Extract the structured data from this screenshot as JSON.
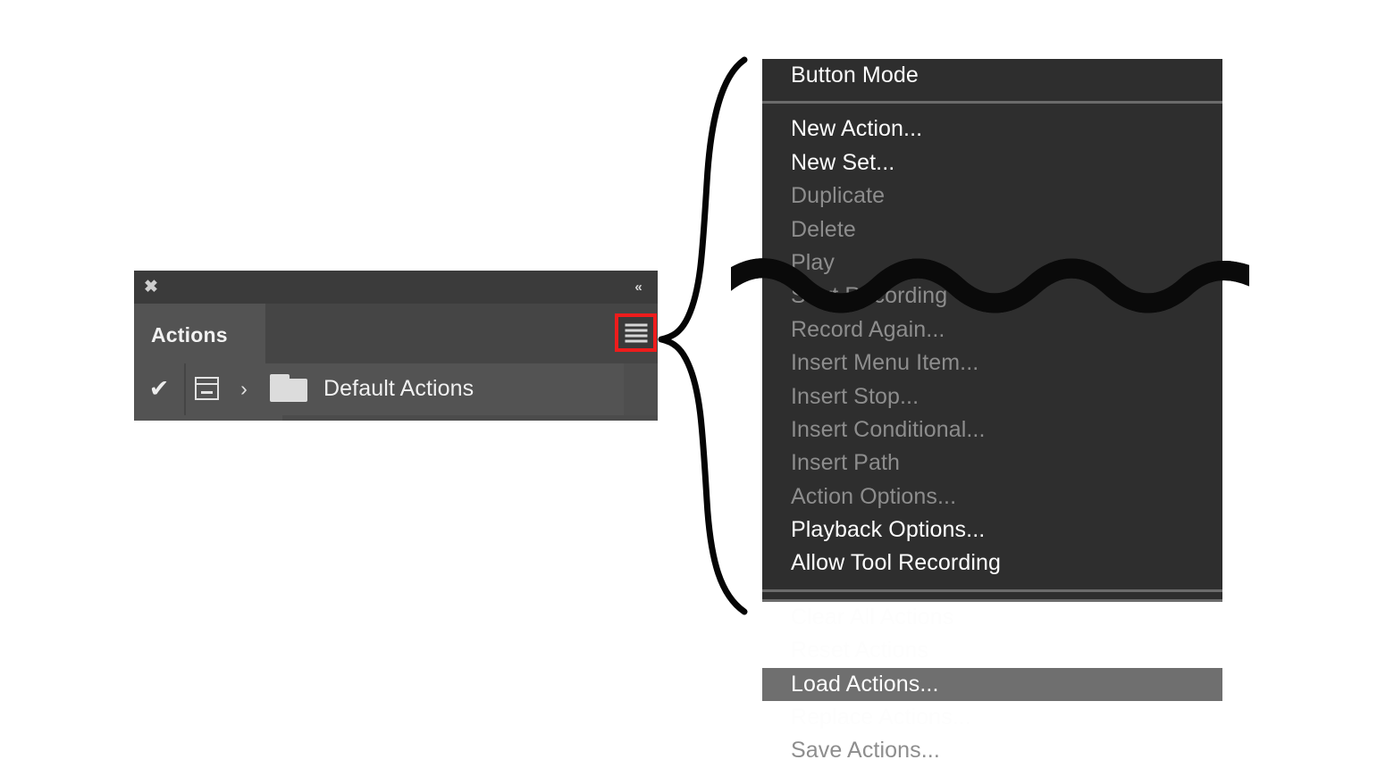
{
  "panel": {
    "title_tab": "Actions",
    "close_icon": "close-icon",
    "close_glyph": "✖",
    "collapse_icon": "double-chevron-left-icon",
    "collapse_glyph": "«",
    "menu_icon": "hamburger-menu-icon",
    "highlight_color": "#ee1c1c",
    "background_color": "#535353",
    "titlebar_color": "#3b3b3b",
    "row": {
      "check_glyph": "✔",
      "check_icon": "checkmark-icon",
      "dialog_icon": "toggle-dialog-icon",
      "expand_glyph": "›",
      "expand_icon": "chevron-right-icon",
      "folder_icon": "folder-icon",
      "label": "Default Actions"
    }
  },
  "flyout_menu": {
    "background_color": "#2e2e2e",
    "highlight_color": "#6f6f6f",
    "text_color": "#fdfdfd",
    "disabled_color": "#8d8d8d",
    "groups": [
      {
        "items": [
          {
            "label": "Button Mode",
            "state": "enabled"
          }
        ]
      },
      {
        "items": [
          {
            "label": "New Action...",
            "state": "enabled"
          },
          {
            "label": "New Set...",
            "state": "enabled"
          },
          {
            "label": "Duplicate",
            "state": "disabled"
          },
          {
            "label": "Delete",
            "state": "disabled"
          },
          {
            "label": "Play",
            "state": "disabled"
          },
          {
            "label": "Start Recording",
            "state": "disabled"
          },
          {
            "label": "Record Again...",
            "state": "disabled"
          },
          {
            "label": "Insert Menu Item...",
            "state": "disabled"
          },
          {
            "label": "Insert Stop...",
            "state": "disabled"
          },
          {
            "label": "Insert Conditional...",
            "state": "disabled"
          },
          {
            "label": "Insert Path",
            "state": "disabled"
          },
          {
            "label": "Action Options...",
            "state": "disabled"
          },
          {
            "label": "Playback Options...",
            "state": "enabled"
          },
          {
            "label": "Allow Tool Recording",
            "state": "enabled"
          }
        ]
      },
      {
        "items": [
          {
            "label": "Clear All Actions",
            "state": "enabled"
          },
          {
            "label": "Reset Actions",
            "state": "enabled"
          },
          {
            "label": "Load Actions...",
            "state": "highlighted"
          },
          {
            "label": "Replace Actions...",
            "state": "enabled"
          },
          {
            "label": "Save Actions...",
            "state": "disabled"
          }
        ]
      }
    ]
  },
  "annotations": {
    "brace": "curly-brace-annotation",
    "wave_break": "wavy-break-line"
  }
}
